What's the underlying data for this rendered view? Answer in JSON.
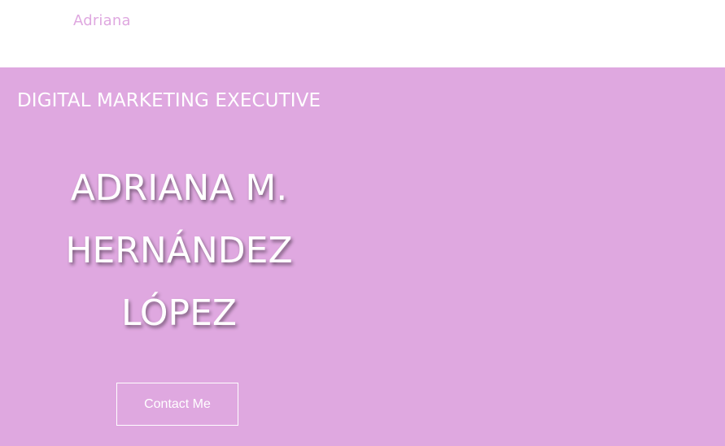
{
  "header": {
    "brand": "Adriana"
  },
  "hero": {
    "subtitle": "DIGITAL MARKETING EXECUTIVE",
    "name_lines": [
      "ADRIANA M.",
      "HERNÁNDEZ",
      "LÓPEZ"
    ],
    "cta_label": "Contact Me"
  },
  "colors": {
    "accent": "#dfa8e0",
    "text": "#ffffff"
  }
}
